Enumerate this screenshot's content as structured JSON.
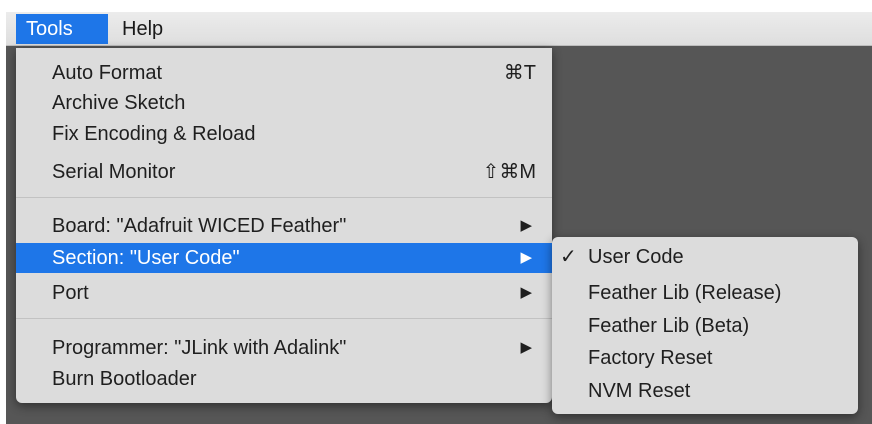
{
  "menubar": {
    "items": [
      {
        "label": "Tools",
        "active": true
      },
      {
        "label": "Help",
        "active": false
      }
    ]
  },
  "tools_menu": {
    "auto_format": {
      "label": "Auto Format",
      "shortcut": "⌘T"
    },
    "archive_sketch": {
      "label": "Archive Sketch"
    },
    "fix_encoding": {
      "label": "Fix Encoding & Reload"
    },
    "serial_monitor": {
      "label": "Serial Monitor",
      "shortcut": "⇧⌘M"
    },
    "board": {
      "label": "Board: \"Adafruit WICED Feather\"",
      "arrow": "▶"
    },
    "section": {
      "label": "Section: \"User Code\"",
      "arrow": "▶"
    },
    "port": {
      "label": "Port",
      "arrow": "▶"
    },
    "programmer": {
      "label": "Programmer: \"JLink with Adalink\"",
      "arrow": "▶"
    },
    "burn_bootloader": {
      "label": "Burn Bootloader"
    }
  },
  "section_submenu": {
    "items": [
      {
        "label": "User Code",
        "checked": true,
        "check": "✓"
      },
      {
        "label": "Feather Lib (Release)",
        "checked": false
      },
      {
        "label": "Feather Lib (Beta)",
        "checked": false
      },
      {
        "label": "Factory Reset",
        "checked": false
      },
      {
        "label": "NVM Reset",
        "checked": false
      }
    ]
  },
  "colors": {
    "highlight": "#1e76e8",
    "menu_bg": "#dcdcdc",
    "backdrop": "#565656"
  }
}
